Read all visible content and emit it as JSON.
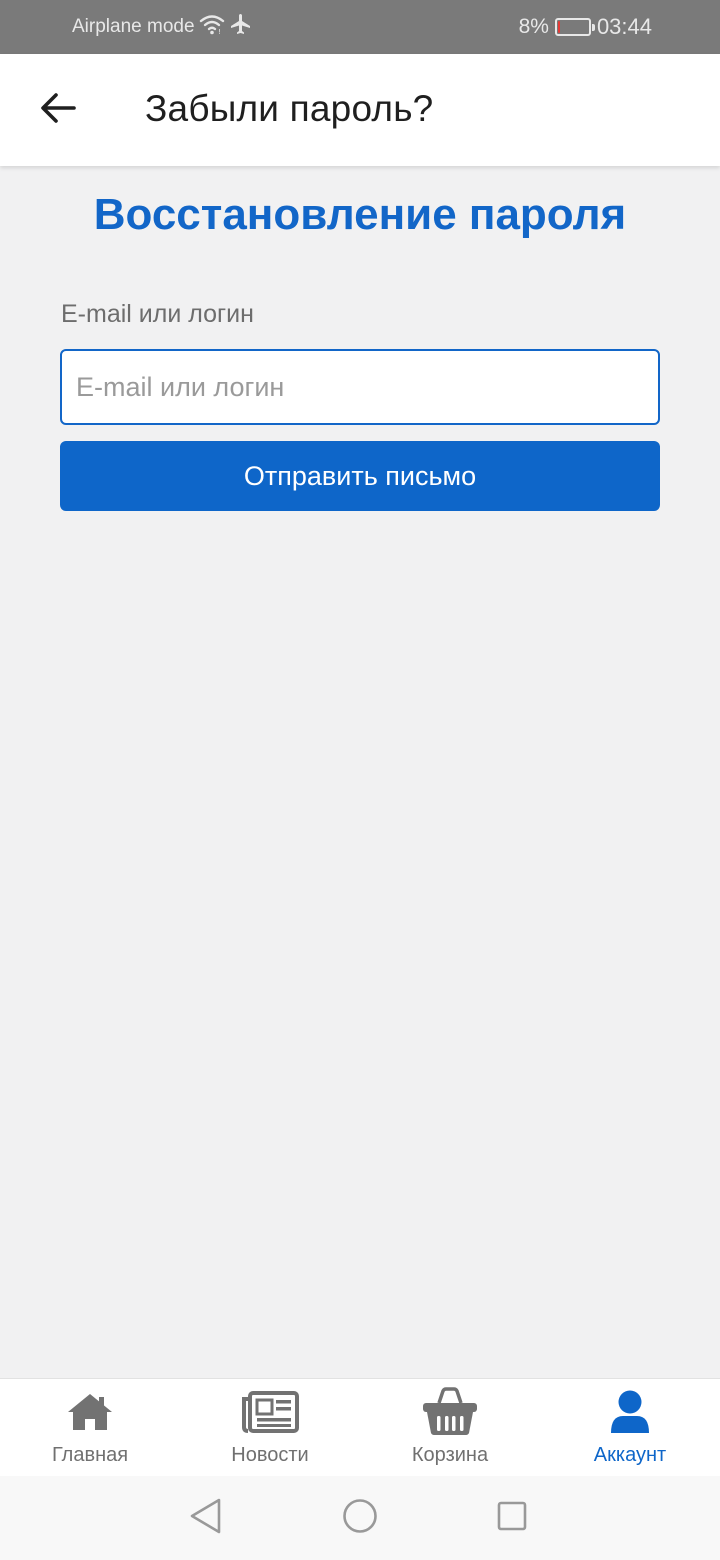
{
  "status_bar": {
    "airplane_label": "Airplane mode",
    "battery_percent": "8%",
    "battery_level": 0.08,
    "time": "03:44",
    "icons": [
      "wifi-icon",
      "airplane-icon",
      "battery-icon"
    ]
  },
  "app_bar": {
    "title": "Забыли пароль?",
    "back_icon": "arrow-left-icon"
  },
  "form": {
    "heading": "Восстановление пароля",
    "field_label": "E-mail или логин",
    "input_value": "",
    "input_placeholder": "E-mail или логин",
    "submit_label": "Отправить письмо"
  },
  "bottom_nav": {
    "items": [
      {
        "label": "Главная",
        "icon": "home-icon",
        "active": false
      },
      {
        "label": "Новости",
        "icon": "newspaper-icon",
        "active": false
      },
      {
        "label": "Корзина",
        "icon": "basket-icon",
        "active": false
      },
      {
        "label": "Аккаунт",
        "icon": "user-icon",
        "active": true
      }
    ]
  },
  "system_nav": {
    "buttons": [
      "back-triangle-icon",
      "home-circle-icon",
      "recents-square-icon"
    ]
  },
  "colors": {
    "accent": "#0e66c9",
    "heading": "#1266c8",
    "background": "#f1f1f2",
    "status_bar": "#7a7a7a",
    "inactive": "#707070",
    "battery_low": "#e53935"
  }
}
